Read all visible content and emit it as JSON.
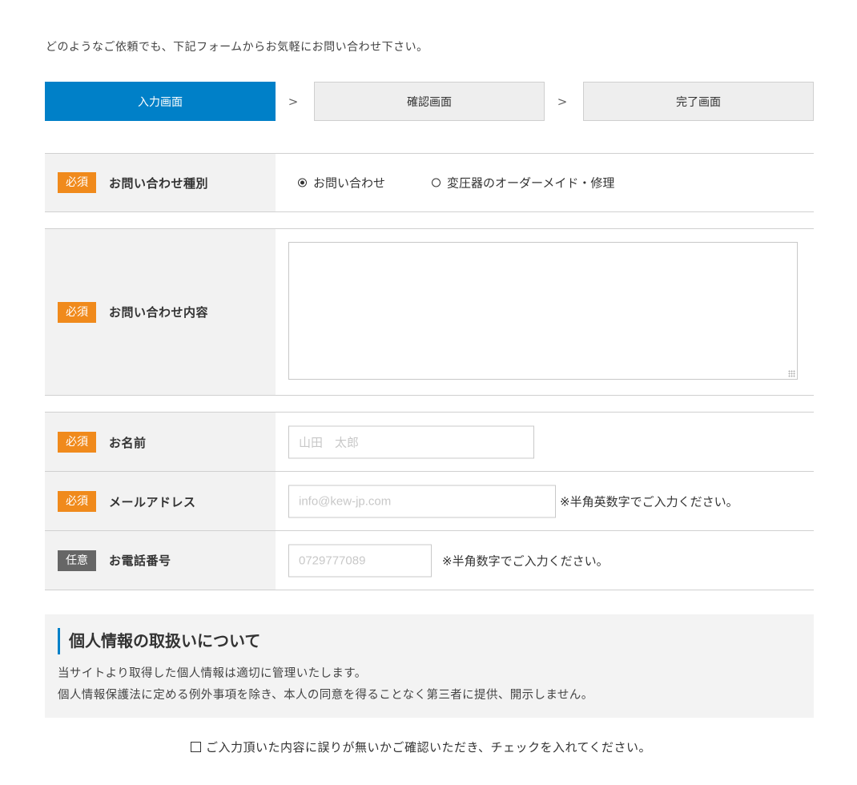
{
  "intro": "どのようなご依頼でも、下記フォームからお気軽にお問い合わせ下さい。",
  "steps": {
    "items": [
      "入力画面",
      "確認画面",
      "完了画面"
    ],
    "separator": ">"
  },
  "badges": {
    "required": "必須",
    "optional": "任意"
  },
  "form": {
    "inquiry_type": {
      "label": "お問い合わせ種別",
      "options": [
        "お問い合わせ",
        "変圧器のオーダーメイド・修理"
      ],
      "selected": "お問い合わせ"
    },
    "inquiry_content": {
      "label": "お問い合わせ内容",
      "value": ""
    },
    "name": {
      "label": "お名前",
      "placeholder": "山田　太郎"
    },
    "email": {
      "label": "メールアドレス",
      "placeholder": "info@kew-jp.com",
      "note": "※半角英数字でご入力ください。"
    },
    "phone": {
      "label": "お電話番号",
      "placeholder": "0729777089",
      "note": "※半角数字でご入力ください。"
    }
  },
  "privacy": {
    "title": "個人情報の取扱いについて",
    "lines": [
      "当サイトより取得した個人情報は適切に管理いたします。",
      "個人情報保護法に定める例外事項を除き、本人の同意を得ることなく第三者に提供、開示しません。"
    ]
  },
  "confirm_text": "ご入力頂いた内容に誤りが無いかご確認いただき、チェックを入れてください。",
  "colors": {
    "accent": "#0080c8",
    "required_badge": "#f08a1c",
    "optional_badge": "#666666",
    "label_bg": "#f2f2f2"
  }
}
